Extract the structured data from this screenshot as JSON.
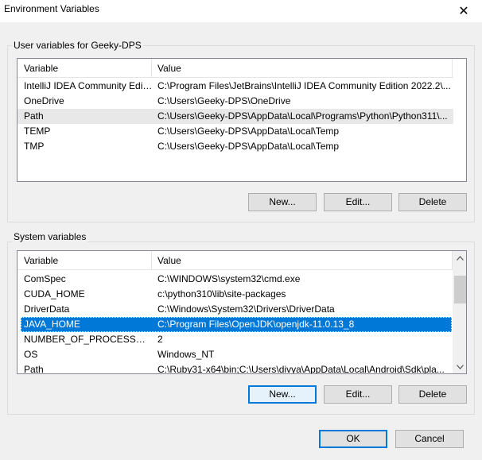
{
  "window": {
    "title": "Environment Variables",
    "close_glyph": "✕"
  },
  "user_group": {
    "label": "User variables for Geeky-DPS",
    "columns": [
      "Variable",
      "Value"
    ],
    "rows": [
      {
        "variable": "IntelliJ IDEA Community Edit...",
        "value": "C:\\Program Files\\JetBrains\\IntelliJ IDEA Community Edition 2022.2\\..."
      },
      {
        "variable": "OneDrive",
        "value": "C:\\Users\\Geeky-DPS\\OneDrive"
      },
      {
        "variable": "Path",
        "value": "C:\\Users\\Geeky-DPS\\AppData\\Local\\Programs\\Python\\Python311\\..."
      },
      {
        "variable": "TEMP",
        "value": "C:\\Users\\Geeky-DPS\\AppData\\Local\\Temp"
      },
      {
        "variable": "TMP",
        "value": "C:\\Users\\Geeky-DPS\\AppData\\Local\\Temp"
      }
    ],
    "buttons": {
      "new": "New...",
      "edit": "Edit...",
      "delete": "Delete"
    }
  },
  "system_group": {
    "label": "System variables",
    "columns": [
      "Variable",
      "Value"
    ],
    "rows": [
      {
        "variable": "ComSpec",
        "value": "C:\\WINDOWS\\system32\\cmd.exe"
      },
      {
        "variable": "CUDA_HOME",
        "value": "c:\\python310\\lib\\site-packages"
      },
      {
        "variable": "DriverData",
        "value": "C:\\Windows\\System32\\Drivers\\DriverData"
      },
      {
        "variable": "JAVA_HOME",
        "value": "C:\\Program Files\\OpenJDK\\openjdk-11.0.13_8"
      },
      {
        "variable": "NUMBER_OF_PROCESSORS",
        "value": "2"
      },
      {
        "variable": "OS",
        "value": "Windows_NT"
      },
      {
        "variable": "Path",
        "value": "C:\\Ruby31-x64\\bin;C:\\Users\\divya\\AppData\\Local\\Android\\Sdk\\pla..."
      }
    ],
    "buttons": {
      "new": "New...",
      "edit": "Edit...",
      "delete": "Delete"
    }
  },
  "footer": {
    "ok": "OK",
    "cancel": "Cancel"
  },
  "colors": {
    "selection": "#0078d7",
    "window_bg": "#f0f0f0",
    "button_bg": "#e1e1e1"
  }
}
